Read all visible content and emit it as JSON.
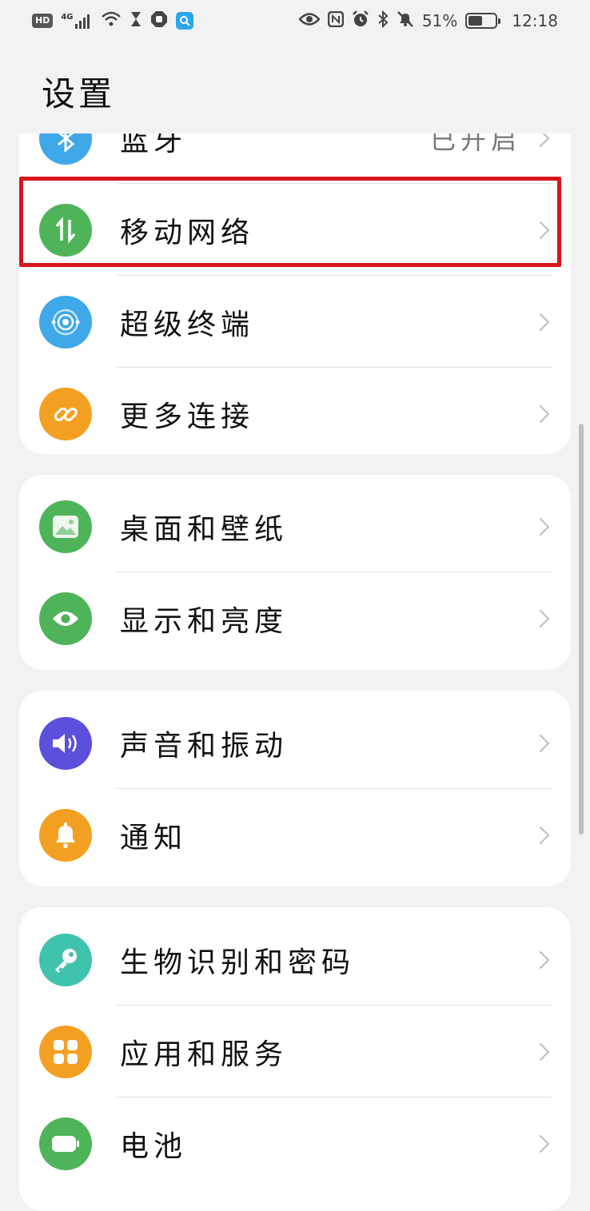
{
  "status_bar": {
    "hd": "HD",
    "network": "4G",
    "battery_percent": "51%",
    "battery_level": 0.51,
    "time": "12:18"
  },
  "page": {
    "title": "设置"
  },
  "cards": [
    {
      "rows": [
        {
          "label": "蓝牙",
          "value": "已开启",
          "icon": "bluetooth-icon",
          "color": "#3ea8e8"
        },
        {
          "label": "移动网络",
          "icon": "mobile-data-icon",
          "color": "#4fb35a"
        },
        {
          "label": "超级终端",
          "icon": "super-device-icon",
          "color": "#3ea8e8"
        },
        {
          "label": "更多连接",
          "icon": "link-icon",
          "color": "#f3a022"
        }
      ]
    },
    {
      "rows": [
        {
          "label": "桌面和壁纸",
          "icon": "wallpaper-icon",
          "color": "#4fb35a"
        },
        {
          "label": "显示和亮度",
          "icon": "eye-icon",
          "color": "#4fb35a"
        }
      ]
    },
    {
      "rows": [
        {
          "label": "声音和振动",
          "icon": "speaker-icon",
          "color": "#5b4fdc"
        },
        {
          "label": "通知",
          "icon": "bell-icon",
          "color": "#f3a022"
        }
      ]
    },
    {
      "rows": [
        {
          "label": "生物识别和密码",
          "icon": "key-icon",
          "color": "#3fc3ad"
        },
        {
          "label": "应用和服务",
          "icon": "apps-icon",
          "color": "#f3a022"
        },
        {
          "label": "电池",
          "icon": "battery-icon",
          "color": "#4fb35a"
        }
      ]
    }
  ]
}
